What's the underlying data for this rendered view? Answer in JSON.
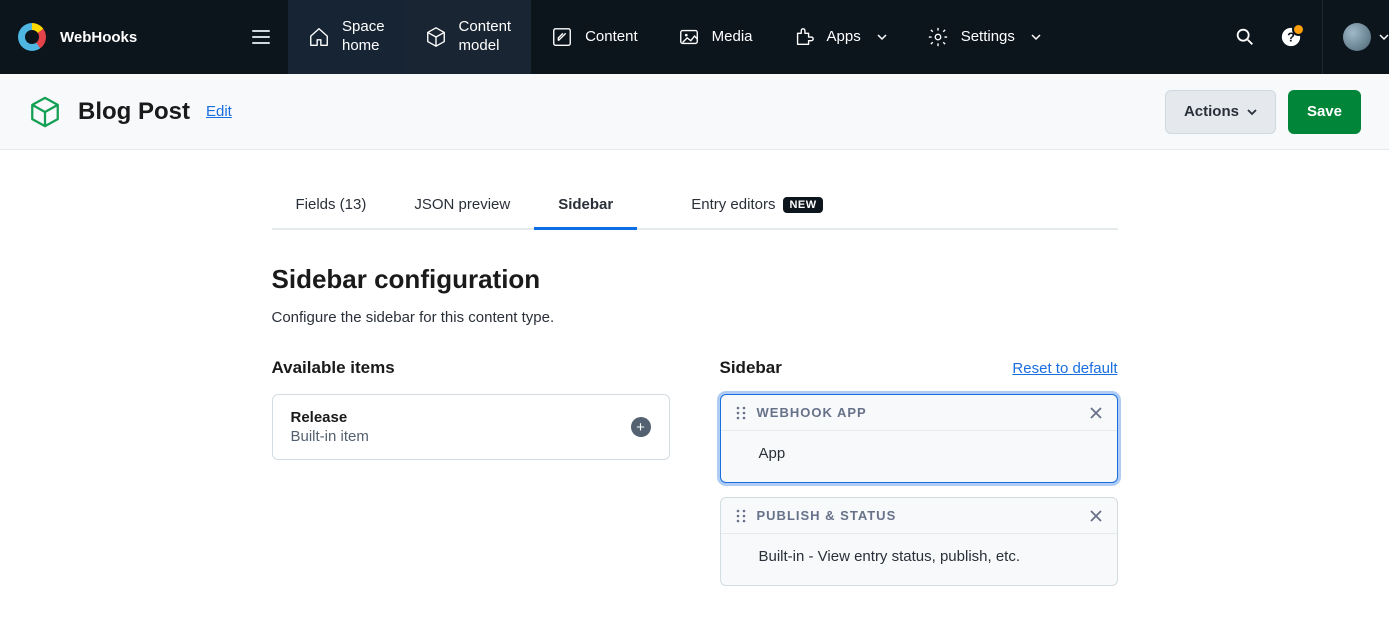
{
  "header": {
    "workspace": "WebHooks",
    "nav": [
      {
        "label": "Space\nhome"
      },
      {
        "label": "Content\nmodel"
      },
      {
        "label": "Content"
      },
      {
        "label": "Media"
      },
      {
        "label": "Apps"
      },
      {
        "label": "Settings"
      }
    ]
  },
  "subheader": {
    "title": "Blog Post",
    "edit": "Edit",
    "actions": "Actions",
    "save": "Save"
  },
  "tabs": {
    "fields": "Fields (13)",
    "json": "JSON preview",
    "sidebar": "Sidebar",
    "entry": "Entry editors",
    "new_badge": "NEW"
  },
  "section": {
    "title": "Sidebar configuration",
    "subtitle": "Configure the sidebar for this content type."
  },
  "available": {
    "heading": "Available items",
    "items": [
      {
        "name": "Release",
        "sub": "Built-in item"
      }
    ]
  },
  "sidebar_col": {
    "heading": "Sidebar",
    "reset": "Reset to default",
    "cards": [
      {
        "title": "WEBHOOK APP",
        "body": "App",
        "selected": true
      },
      {
        "title": "PUBLISH & STATUS",
        "body": "Built-in - View entry status, publish, etc.",
        "selected": false
      }
    ]
  }
}
